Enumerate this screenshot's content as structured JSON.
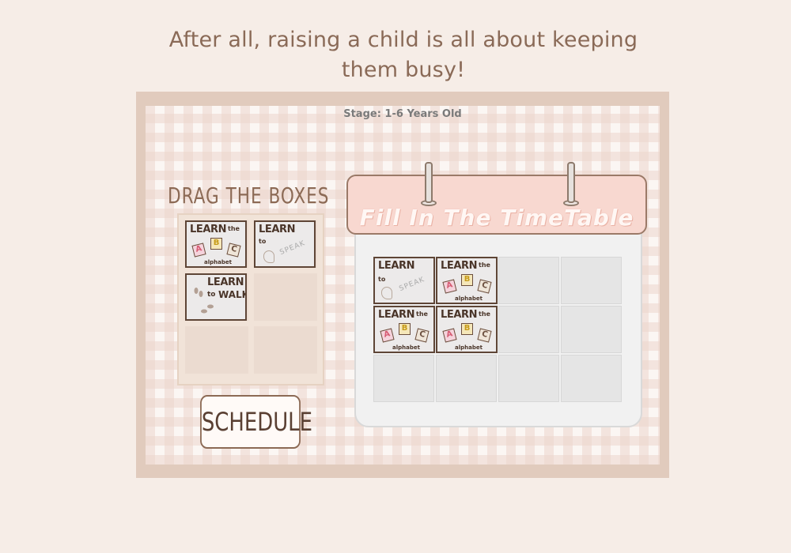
{
  "caption": "After all, raising a child is all about keeping them busy!",
  "game": {
    "stage_label": "Stage: 1-6 Years Old",
    "drag_title": "DRAG THE BOXES",
    "schedule_button": "SCHEDULE",
    "timetable_title": "Fill In The TimeTable"
  },
  "cards": {
    "abc": {
      "learn": "LEARN",
      "the": "the",
      "letters": [
        "A",
        "B",
        "C"
      ],
      "note": "alphabet"
    },
    "speak": {
      "learn": "LEARN",
      "to": "to",
      "speak": "SPEAK"
    },
    "walk": {
      "learn": "LEARN",
      "to": "to",
      "walk": "WALK"
    }
  },
  "tray_slots": [
    {
      "card": "abc"
    },
    {
      "card": "speak"
    },
    {
      "card": "walk"
    },
    {
      "card": null
    },
    {
      "card": null
    },
    {
      "card": null
    }
  ],
  "timetable": {
    "rows": 3,
    "cols": 4,
    "filled": [
      {
        "row": 0,
        "col": 0,
        "card": "speak"
      },
      {
        "row": 0,
        "col": 1,
        "card": "abc"
      },
      {
        "row": 1,
        "col": 0,
        "card": "abc"
      },
      {
        "row": 1,
        "col": 1,
        "card": "abc"
      }
    ]
  },
  "colors": {
    "background": "#f6ede7",
    "frame": "#e1cbbd",
    "caption_text": "#8a6a57",
    "header_pink": "#f8d8d0",
    "card_border": "#5e4536"
  },
  "icons": [
    "footprints-icon",
    "head-silhouette-icon",
    "binder-ring-icon"
  ]
}
